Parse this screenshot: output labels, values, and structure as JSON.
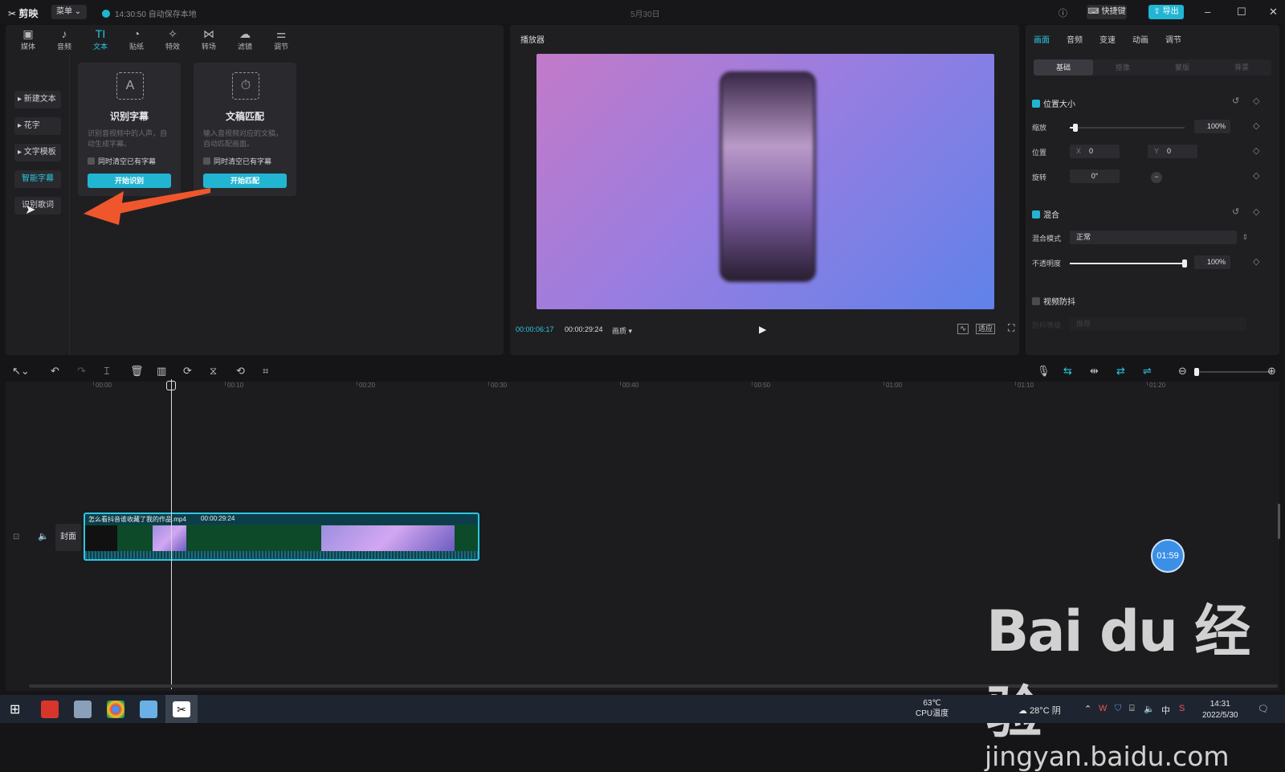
{
  "app": {
    "name": "剪映",
    "menu_label": "菜单",
    "autosave": "14:30:50 自动保存本地",
    "project_date": "5月30日",
    "shortcut_label": "快捷键",
    "export_label": "导出"
  },
  "toolbar": [
    {
      "icon": "media-icon",
      "glyph": "▣",
      "label": "媒体"
    },
    {
      "icon": "audio-icon",
      "glyph": "♪",
      "label": "音频"
    },
    {
      "icon": "text-icon",
      "glyph": "TI",
      "label": "文本"
    },
    {
      "icon": "sticker-icon",
      "glyph": "◔",
      "label": "贴纸"
    },
    {
      "icon": "effects-icon",
      "glyph": "✧",
      "label": "特效"
    },
    {
      "icon": "transition-icon",
      "glyph": "⋈",
      "label": "转场"
    },
    {
      "icon": "filter-icon",
      "glyph": "☁",
      "label": "滤镜"
    },
    {
      "icon": "adjust-icon",
      "glyph": "⚌",
      "label": "调节"
    }
  ],
  "sidebar": [
    {
      "label": "▸ 新建文本"
    },
    {
      "label": "▸ 花字"
    },
    {
      "label": "▸ 文字模板"
    },
    {
      "label": "智能字幕"
    },
    {
      "label": "识别歌词"
    }
  ],
  "cards": [
    {
      "title": "识别字幕",
      "desc": "识别音视频中的人声，自动生成字幕。",
      "check": "同时清空已有字幕",
      "button": "开始识别"
    },
    {
      "title": "文稿匹配",
      "desc": "输入音视频对应的文稿，自动匹配画面。",
      "check": "同时清空已有字幕",
      "button": "开始匹配"
    }
  ],
  "player": {
    "header": "播放器",
    "current_time": "00:00:06:17",
    "total_time": "00:00:29:24",
    "quality": "画质",
    "ratio": "适应"
  },
  "inspector": {
    "tabs": [
      "画面",
      "音频",
      "变速",
      "动画",
      "调节"
    ],
    "subtabs": [
      "基础",
      "抠像",
      "蒙版",
      "背景"
    ],
    "position_section": "位置大小",
    "scale_label": "缩放",
    "scale_value": "100%",
    "position_label": "位置",
    "pos_x_label": "X",
    "pos_x": "0",
    "pos_y_label": "Y",
    "pos_y": "0",
    "rotate_label": "旋转",
    "rotate_value": "0°",
    "blend_section": "混合",
    "blend_mode_label": "混合模式",
    "blend_mode_value": "正常",
    "opacity_label": "不透明度",
    "opacity_value": "100%",
    "stabilize_section": "视频防抖",
    "stabilize_label": "防抖等级",
    "stabilize_value": "推荐",
    "scale_level": 0.05,
    "opacity_level": 1.0
  },
  "timeline": {
    "ticks": [
      "00:00",
      "00:10",
      "00:20",
      "00:30",
      "00:40",
      "00:50",
      "01:00",
      "01:10",
      "01:20"
    ],
    "clip_name": "怎么看抖音谁收藏了我的作品.mp4",
    "clip_duration": "00:00:29:24",
    "cover_label": "封面",
    "bubble_time": "01:59"
  },
  "watermark": {
    "line1": "Bai du 经验",
    "line2": "jingyan.baidu.com"
  },
  "taskbar": {
    "cpu_temp": "63℃",
    "cpu_label": "CPU温度",
    "weather": "28°C 阴",
    "ime": "中",
    "time": "14:31",
    "date": "2022/5/30"
  },
  "colors": {
    "accent": "#22b5d2",
    "arrow": "#f0562c"
  }
}
